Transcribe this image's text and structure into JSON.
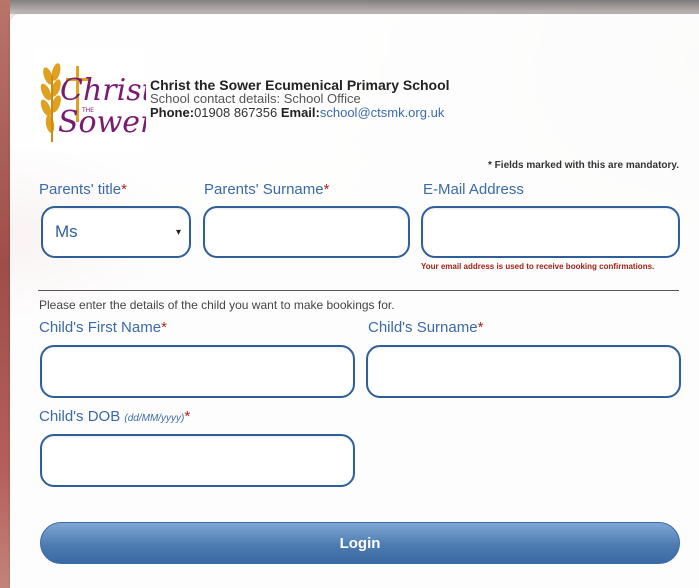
{
  "header": {
    "logo_text": "Christ the Sower",
    "school_name": "Christ the Sower Ecumenical Primary School",
    "contact_line": "School contact details: School Office",
    "phone_label": "Phone:",
    "phone_value": "01908 867356",
    "email_label": "Email:",
    "email_value": "school@ctsmk.org.uk"
  },
  "form": {
    "mandatory_note": "* Fields marked with this are mandatory.",
    "parents_title": {
      "label": "Parents' title",
      "value": "Ms"
    },
    "parents_surname": {
      "label": "Parents' Surname",
      "value": ""
    },
    "email": {
      "label": "E-Mail Address",
      "value": "",
      "hint": "Your email address is used to receive booking confirmations."
    },
    "instruction": "Please enter the details of the child you want to make bookings for.",
    "child_first_name": {
      "label": "Child's First Name",
      "value": ""
    },
    "child_surname": {
      "label": "Child's Surname",
      "value": ""
    },
    "child_dob": {
      "label": "Child's DOB",
      "format": "(dd/MM/yyyy)",
      "value": ""
    },
    "required_marker": "*",
    "login_label": "Login"
  },
  "colors": {
    "accent": "#3a6aa8",
    "required": "#b22222",
    "button": "#4d7bb2"
  }
}
